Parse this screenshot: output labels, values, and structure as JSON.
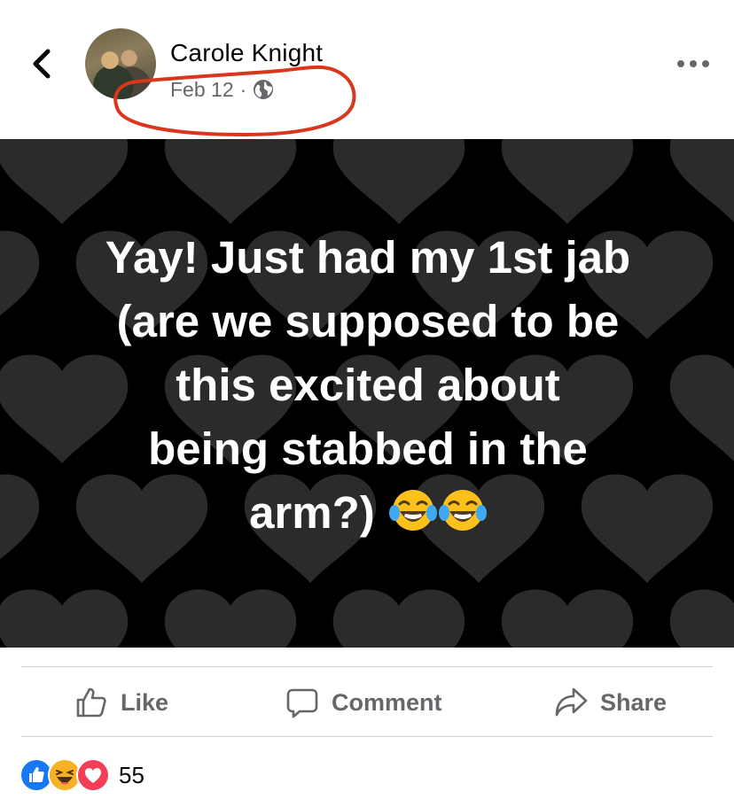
{
  "post": {
    "author": "Carole Knight",
    "date": "Feb 12",
    "separator": "·",
    "privacy_icon": "globe-icon",
    "text_lines": [
      "Yay! Just had my 1st jab",
      "(are we supposed to  be",
      "this excited about",
      "being stabbed in the",
      "arm?)"
    ],
    "emoji": "face-with-tears-of-joy x2",
    "background": "black with grey hearts"
  },
  "actions": {
    "like_label": "Like",
    "comment_label": "Comment",
    "share_label": "Share"
  },
  "reactions": {
    "types": [
      "like",
      "haha",
      "love"
    ],
    "count": "55"
  },
  "colors": {
    "annotation": "#d9361c",
    "like_blue": "#1877f2",
    "love_red": "#f33e58",
    "haha_yellow": "#f7b125",
    "secondary_text": "#65676b"
  }
}
